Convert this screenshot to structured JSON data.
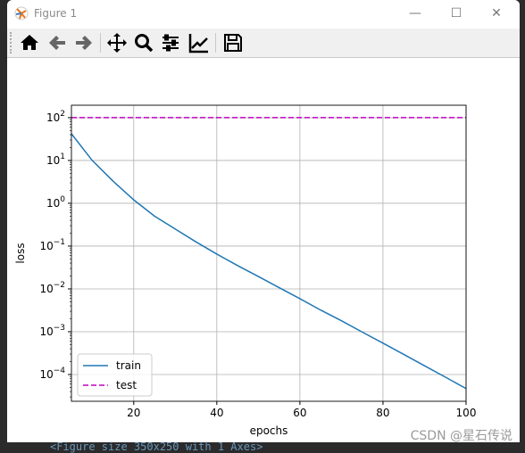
{
  "window": {
    "title": "Figure 1",
    "minimize_icon": "minimize-icon",
    "maximize_icon": "maximize-icon",
    "close_icon": "close-icon"
  },
  "toolbar": {
    "buttons": [
      {
        "name": "home",
        "icon": "home-icon"
      },
      {
        "name": "back",
        "icon": "arrow-left-icon"
      },
      {
        "name": "forward",
        "icon": "arrow-right-icon"
      },
      {
        "name": "pan",
        "icon": "move-icon"
      },
      {
        "name": "zoom",
        "icon": "magnifier-icon"
      },
      {
        "name": "configure-subplots",
        "icon": "sliders-icon"
      },
      {
        "name": "edit-axes",
        "icon": "line-chart-icon"
      },
      {
        "name": "save",
        "icon": "floppy-disk-icon"
      }
    ]
  },
  "console_text": "<Figure size 350x250 with 1 Axes>",
  "watermark": "CSDN @星石传说",
  "chart_data": {
    "type": "line",
    "xlabel": "epochs",
    "ylabel": "loss",
    "xlim": [
      5,
      100
    ],
    "ylim": [
      2.37e-05,
      195
    ],
    "yscale": "log",
    "grid": true,
    "legend_position": "lower-left",
    "xticks": [
      "20",
      "40",
      "60",
      "80",
      "100"
    ],
    "xtick_values": [
      20,
      40,
      60,
      80,
      100
    ],
    "yticks": [
      "10^2",
      "10^1",
      "10^0",
      "10^-1",
      "10^-2",
      "10^-3",
      "10^-4"
    ],
    "ytick_exponents": [
      2,
      1,
      0,
      -1,
      -2,
      -3,
      -4
    ],
    "series": [
      {
        "name": "train",
        "color": "#1f77b4",
        "style": "solid",
        "x": [
          5,
          10,
          15,
          20,
          25,
          30,
          35,
          40,
          45,
          50,
          55,
          60,
          65,
          70,
          75,
          80,
          85,
          90,
          95,
          100
        ],
        "y": [
          42,
          10,
          3.3,
          1.2,
          0.5,
          0.25,
          0.125,
          0.065,
          0.035,
          0.0195,
          0.0107,
          0.0059,
          0.0032,
          0.0018,
          0.00098,
          0.00054,
          0.000295,
          0.00016,
          8.7e-05,
          4.7e-05
        ]
      },
      {
        "name": "test",
        "color": "#bf00bf",
        "style": "dashed",
        "x": [
          5,
          100
        ],
        "y": [
          100,
          100
        ]
      }
    ]
  }
}
